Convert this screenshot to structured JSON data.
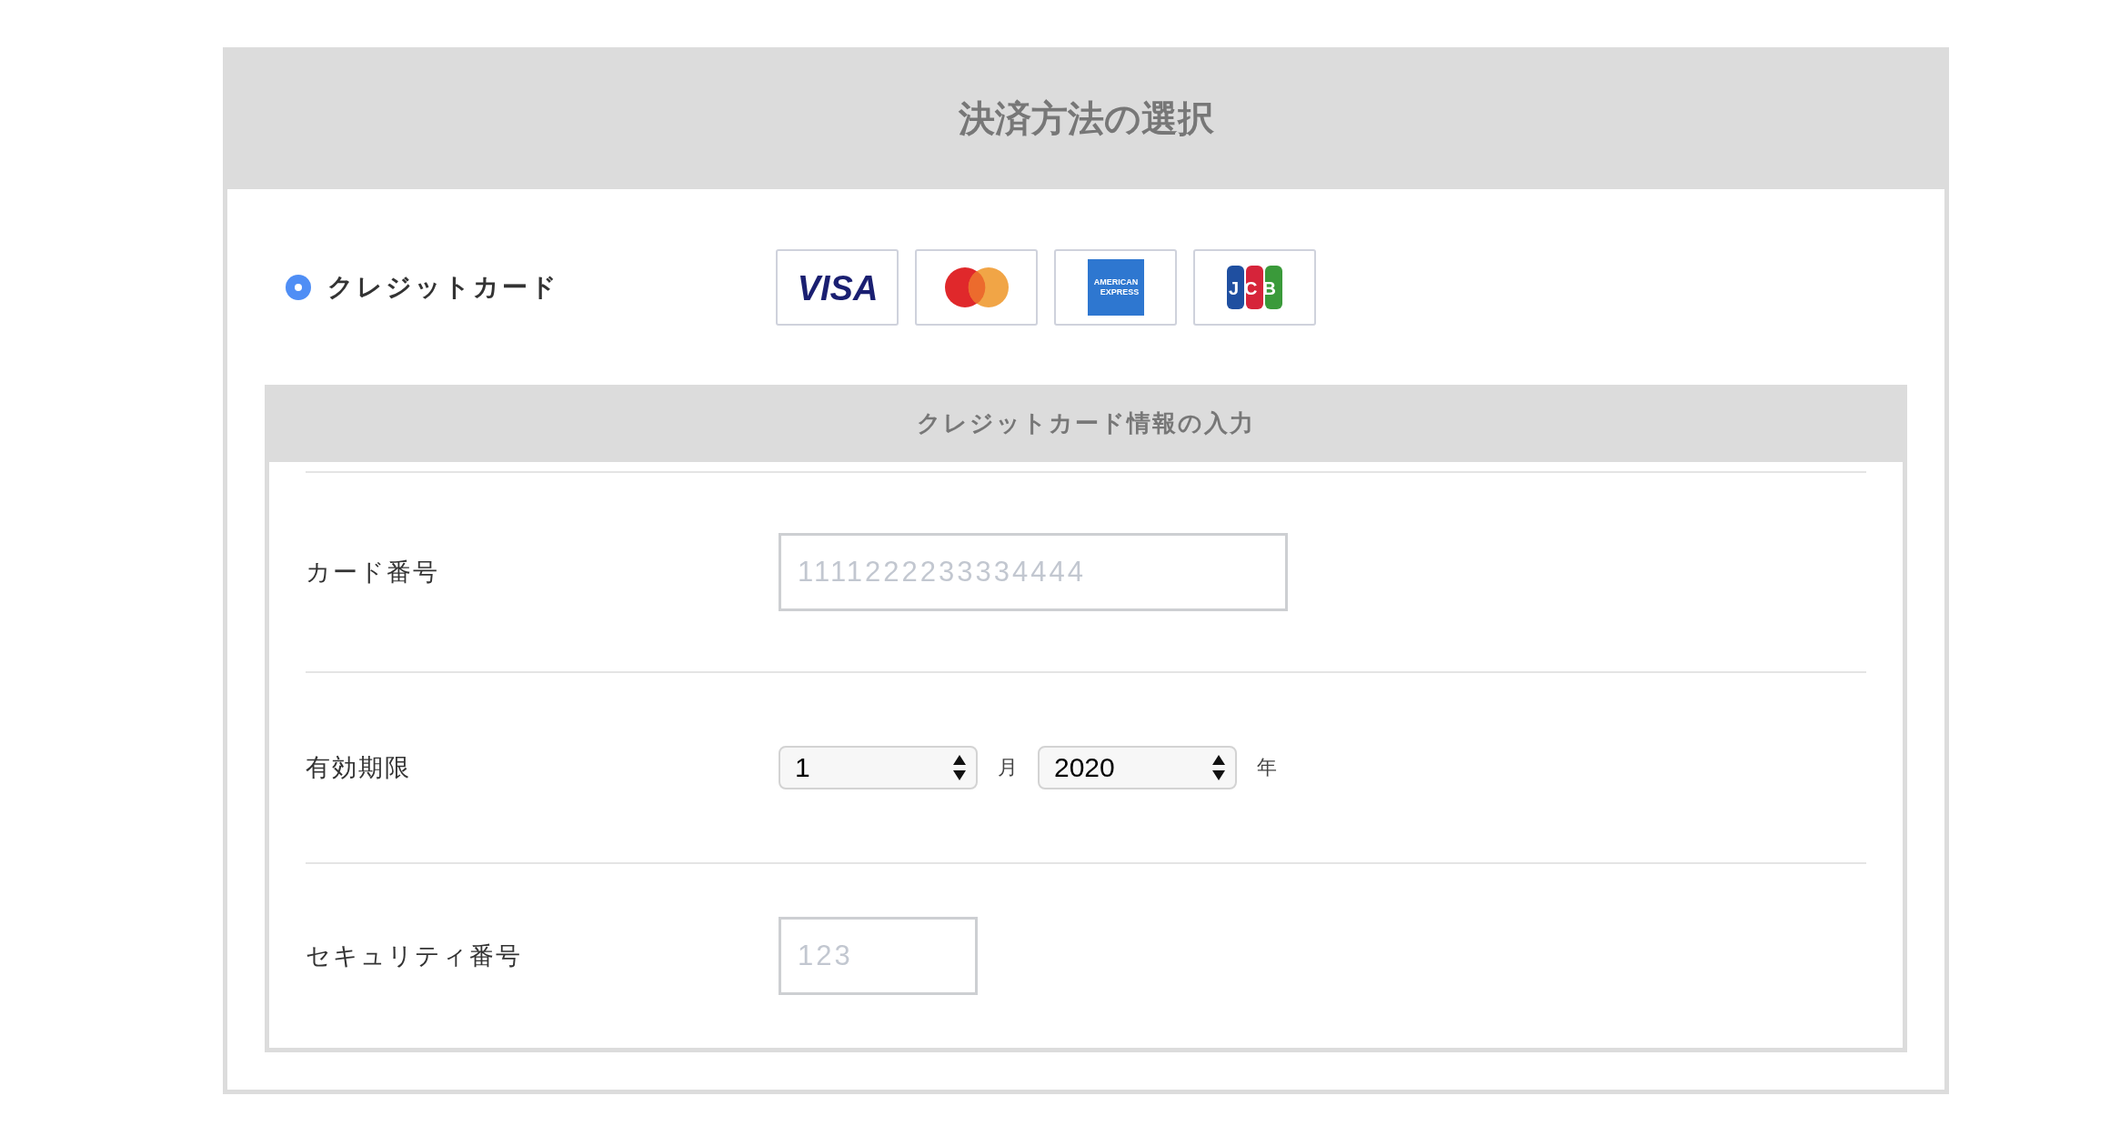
{
  "title": "決済方法の選択",
  "payment_options": [
    {
      "label": "クレジットカード",
      "selected": true
    }
  ],
  "card_brands": [
    {
      "kind": "visa",
      "label": "VISA"
    },
    {
      "kind": "mastercard"
    },
    {
      "kind": "amex",
      "label": "AMERICAN EXPRESS"
    },
    {
      "kind": "jcb",
      "label": "JCB"
    }
  ],
  "card_form": {
    "title": "クレジットカード情報の入力",
    "rows": [
      {
        "kind": "card_number",
        "label": "カード番号",
        "placeholder": "1111222233334444"
      },
      {
        "kind": "expiry",
        "label": "有効期限",
        "month": "1",
        "month_unit": "月",
        "year": "2020",
        "year_unit": "年"
      },
      {
        "kind": "security_code",
        "label": "セキュリティ番号",
        "placeholder": "123"
      }
    ]
  }
}
